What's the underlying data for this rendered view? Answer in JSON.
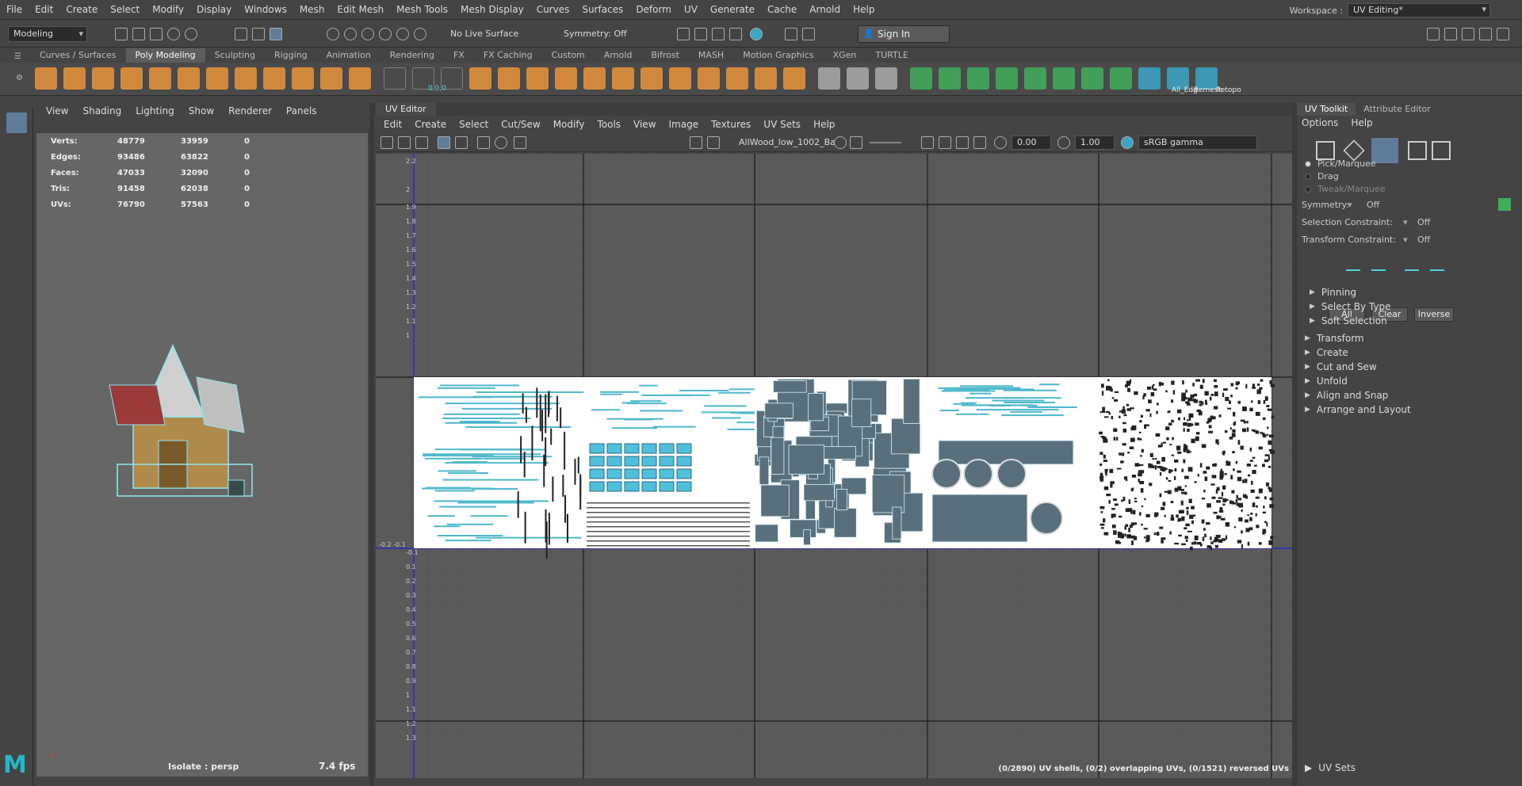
{
  "menubar": {
    "items": [
      "File",
      "Edit",
      "Create",
      "Select",
      "Modify",
      "Display",
      "Windows",
      "Mesh",
      "Edit Mesh",
      "Mesh Tools",
      "Mesh Display",
      "Curves",
      "Surfaces",
      "Deform",
      "UV",
      "Generate",
      "Cache",
      "Arnold",
      "Help"
    ],
    "workspace_label": "Workspace :",
    "workspace_value": "UV Editing*"
  },
  "statusline": {
    "mode": "Modeling",
    "live_surface": "No Live Surface",
    "symmetry": "Symmetry: Off",
    "sign_in": "Sign In"
  },
  "shelf": {
    "tabs": [
      "Curves / Surfaces",
      "Poly Modeling",
      "Sculpting",
      "Rigging",
      "Animation",
      "Rendering",
      "FX",
      "FX Caching",
      "Custom",
      "Arnold",
      "Bifrost",
      "MASH",
      "Motion Graphics",
      "XGen",
      "TURTLE"
    ],
    "active_tab": "Poly Modeling",
    "labeled_icons": [
      "All_Edg",
      "Remesh",
      "Retopo"
    ],
    "coord_readout": "0,0,0"
  },
  "viewport": {
    "menu": [
      "View",
      "Shading",
      "Lighting",
      "Show",
      "Renderer",
      "Panels"
    ],
    "hud": [
      {
        "label": "Verts:",
        "a": "48779",
        "b": "33959",
        "c": "0"
      },
      {
        "label": "Edges:",
        "a": "93486",
        "b": "63822",
        "c": "0"
      },
      {
        "label": "Faces:",
        "a": "47033",
        "b": "32090",
        "c": "0"
      },
      {
        "label": "Tris:",
        "a": "91458",
        "b": "62038",
        "c": "0"
      },
      {
        "label": "UVs:",
        "a": "76790",
        "b": "57563",
        "c": "0"
      }
    ],
    "isolate": "Isolate : persp",
    "fps": "7.4 fps"
  },
  "uv_editor": {
    "tab": "UV Editor",
    "menu": [
      "Edit",
      "Create",
      "Select",
      "Cut/Sew",
      "Modify",
      "Tools",
      "View",
      "Image",
      "Textures",
      "UV Sets",
      "Help"
    ],
    "texture_name": "AllWood_low_1002_Ba",
    "exposure": "0.00",
    "gamma": "1.00",
    "colorspace": "sRGB gamma",
    "axis_labels_top": [
      "2.2",
      "2",
      "1.9",
      "1.8",
      "1.7",
      "1.6",
      "1.5",
      "1.4",
      "1.3",
      "1.2",
      "1.1",
      "1"
    ],
    "axis_labels_bottom": [
      "-0.1",
      "0.1",
      "0.2",
      "0.3",
      "0.4",
      "0.5",
      "0.6",
      "0.7",
      "0.8",
      "0.9",
      "1",
      "1.1",
      "1.2",
      "1.3"
    ],
    "origin_label": "-0.2 -0.1",
    "status": "(0/2890) UV shells, (0/2) overlapping UVs, (0/1521) reversed UVs"
  },
  "uv_toolkit": {
    "tabs": [
      "UV Toolkit",
      "Attribute Editor"
    ],
    "menu": [
      "Options",
      "Help"
    ],
    "modes": [
      "Pick/Marquee",
      "Drag",
      "Tweak/Marquee"
    ],
    "symmetry_label": "Symmetry:",
    "symmetry_value": "Off",
    "selection_constraint_label": "Selection Constraint:",
    "selection_constraint_value": "Off",
    "transform_constraint_label": "Transform Constraint:",
    "transform_constraint_value": "Off",
    "buttons": [
      "All",
      "Clear",
      "Inverse"
    ],
    "subsections": [
      "Pinning",
      "Select By Type",
      "Soft Selection"
    ],
    "sections": [
      "Transform",
      "Create",
      "Cut and Sew",
      "Unfold",
      "Align and Snap",
      "Arrange and Layout"
    ],
    "uv_sets": "UV Sets"
  },
  "colors": {
    "accent_cyan": "#4fd0e0",
    "active_tool": "#5f7c9a",
    "shelf_orange": "#e8943a",
    "shelf_green": "#3fae5a"
  },
  "logo": "M"
}
